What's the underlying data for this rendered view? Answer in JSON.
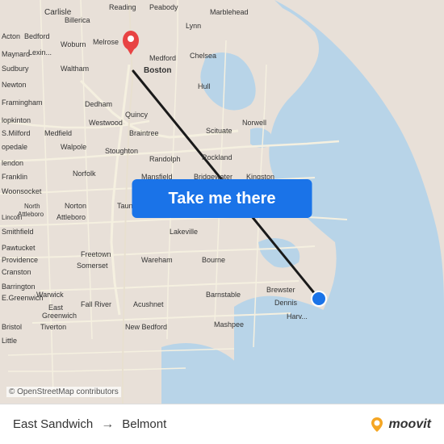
{
  "header": {
    "location_label": "Carlisle"
  },
  "map": {
    "attribution": "© OpenStreetMap contributors",
    "route_line_color": "#1a1a1a",
    "water_color": "#b8d4e8",
    "land_color": "#e8e0d8",
    "road_color": "#f5f0e8",
    "origin_marker_color": "#1a73e8",
    "destination_marker_color": "#e84343",
    "button_label": "Take me there",
    "button_color": "#1a73e8"
  },
  "bottom_bar": {
    "origin": "East Sandwich",
    "destination": "Belmont",
    "arrow": "→",
    "logo_text": "moovit"
  }
}
